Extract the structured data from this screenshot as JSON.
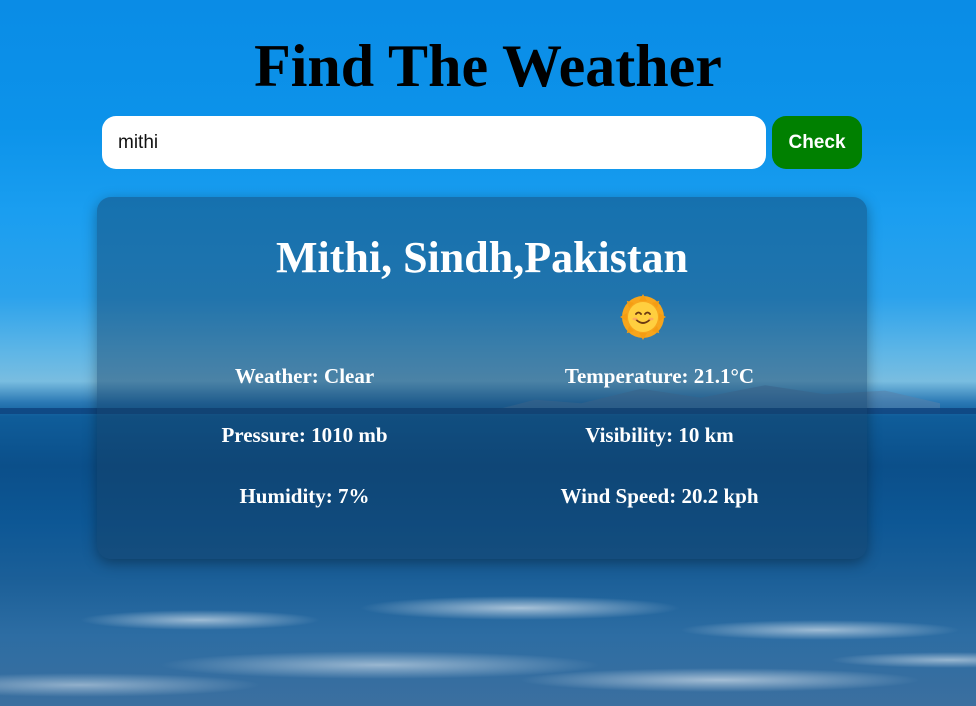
{
  "page": {
    "title": "Find The Weather"
  },
  "search": {
    "value": "mithi",
    "button_label": "Check"
  },
  "result": {
    "location": "Mithi, Sindh,Pakistan",
    "icon": "smiling-sun-icon",
    "stats": {
      "weather": "Weather: Clear",
      "temperature": "Temperature: 21.1°C",
      "pressure": "Pressure: 1010 mb",
      "visibility": "Visibility: 10 km",
      "humidity": "Humidity: 7%",
      "wind_speed": "Wind Speed: 20.2 kph"
    }
  },
  "colors": {
    "button": "#008000",
    "card": "rgba(20,60,95,0.45)",
    "sky": "#0a8ce6"
  }
}
